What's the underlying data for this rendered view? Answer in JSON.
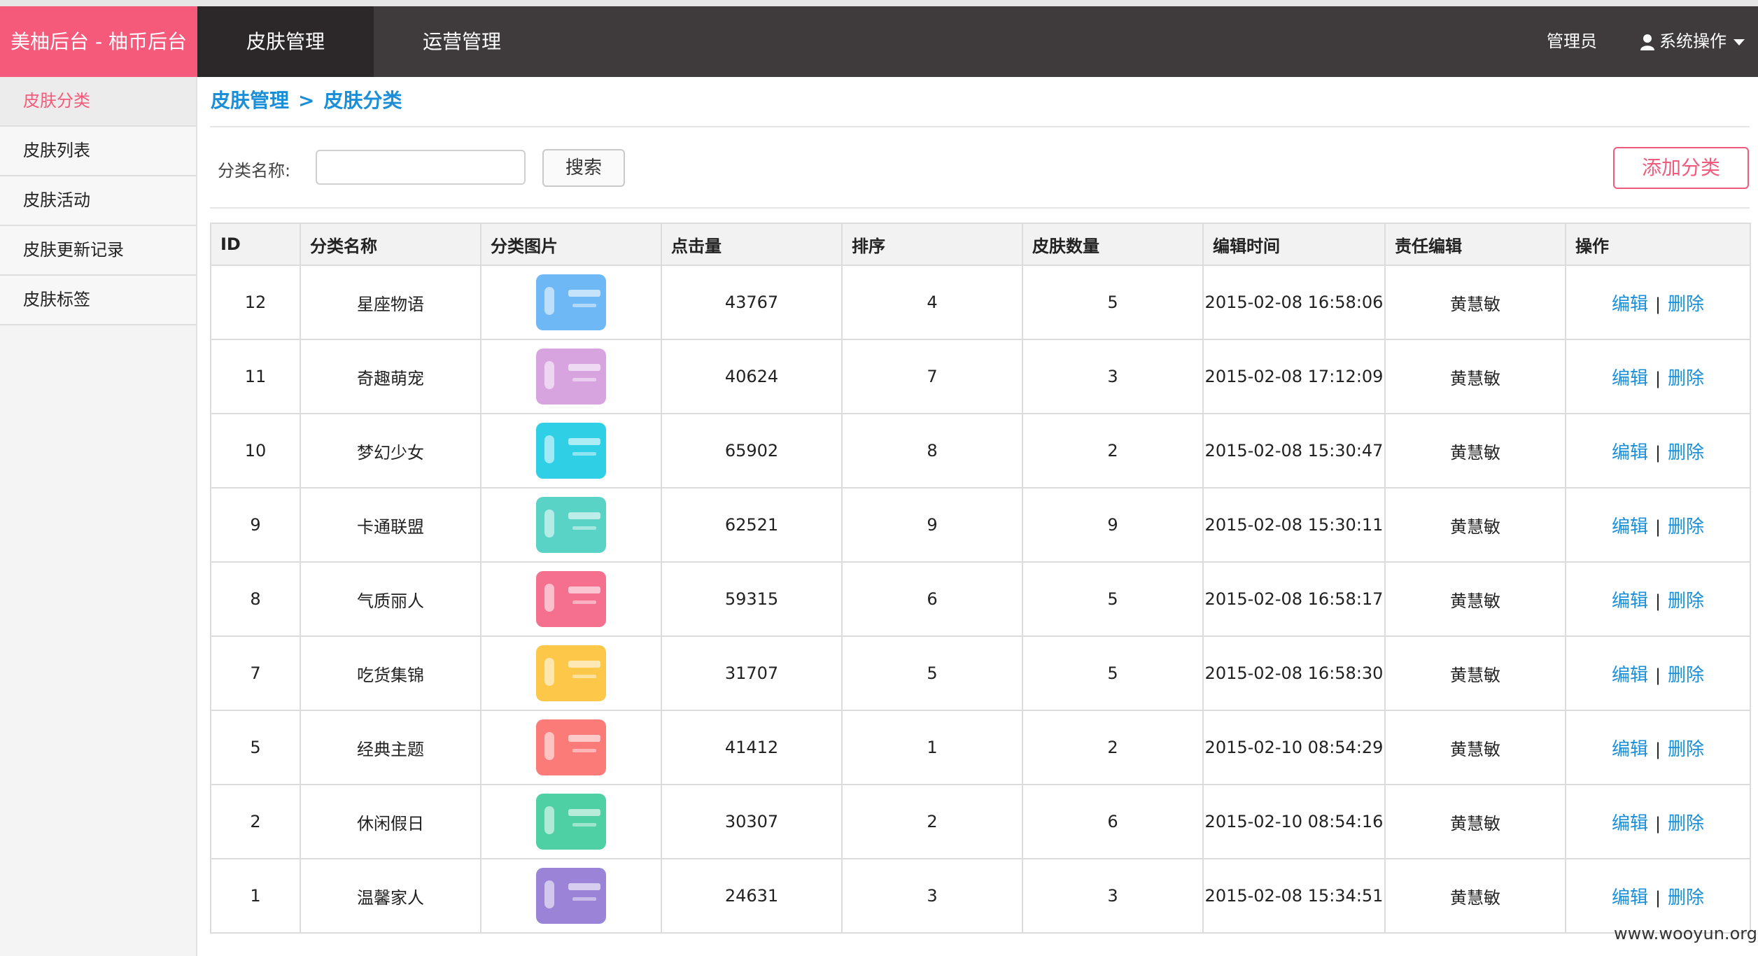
{
  "brand": "美柚后台 - 柚币后台",
  "top_nav": {
    "tab1": "皮肤管理",
    "tab2": "运营管理",
    "admin": "管理员",
    "system_ops": "系统操作"
  },
  "sidebar": {
    "items": [
      "皮肤分类",
      "皮肤列表",
      "皮肤活动",
      "皮肤更新记录",
      "皮肤标签"
    ]
  },
  "breadcrumb": {
    "parent": "皮肤管理",
    "separator": ">",
    "current": "皮肤分类"
  },
  "search": {
    "label": "分类名称:",
    "value": "",
    "button": "搜索"
  },
  "add_button": "添加分类",
  "table": {
    "headers": [
      "ID",
      "分类名称",
      "分类图片",
      "点击量",
      "排序",
      "皮肤数量",
      "编辑时间",
      "责任编辑",
      "操作"
    ],
    "edit_label": "编辑",
    "delete_label": "删除",
    "op_separator": "|",
    "rows": [
      {
        "id": "12",
        "name": "星座物语",
        "clicks": "43767",
        "order": "4",
        "count": "5",
        "time": "2015-02-08 16:58:06",
        "editor": "黄慧敏",
        "thumb_color": "#6eb8f5",
        "thumb_icon": "stars-icon"
      },
      {
        "id": "11",
        "name": "奇趣萌宠",
        "clicks": "40624",
        "order": "7",
        "count": "3",
        "time": "2015-02-08 17:12:09",
        "editor": "黄慧敏",
        "thumb_color": "#d7a4e0",
        "thumb_icon": "pet-icon"
      },
      {
        "id": "10",
        "name": "梦幻少女",
        "clicks": "65902",
        "order": "8",
        "count": "2",
        "time": "2015-02-08 15:30:47",
        "editor": "黄慧敏",
        "thumb_color": "#2fcfe6",
        "thumb_icon": "girl-icon"
      },
      {
        "id": "9",
        "name": "卡通联盟",
        "clicks": "62521",
        "order": "9",
        "count": "9",
        "time": "2015-02-08 15:30:11",
        "editor": "黄慧敏",
        "thumb_color": "#58d3c6",
        "thumb_icon": "cartoon-icon"
      },
      {
        "id": "8",
        "name": "气质丽人",
        "clicks": "59315",
        "order": "6",
        "count": "5",
        "time": "2015-02-08 16:58:17",
        "editor": "黄慧敏",
        "thumb_color": "#f56f8e",
        "thumb_icon": "feather-icon"
      },
      {
        "id": "7",
        "name": "吃货集锦",
        "clicks": "31707",
        "order": "5",
        "count": "5",
        "time": "2015-02-08 16:58:30",
        "editor": "黄慧敏",
        "thumb_color": "#fdc84a",
        "thumb_icon": "icecream-icon"
      },
      {
        "id": "5",
        "name": "经典主题",
        "clicks": "41412",
        "order": "1",
        "count": "2",
        "time": "2015-02-10 08:54:29",
        "editor": "黄慧敏",
        "thumb_color": "#fb7b78",
        "thumb_icon": "phone-icon"
      },
      {
        "id": "2",
        "name": "休闲假日",
        "clicks": "30307",
        "order": "2",
        "count": "6",
        "time": "2015-02-10 08:54:16",
        "editor": "黄慧敏",
        "thumb_color": "#4fd0a4",
        "thumb_icon": "luggage-icon"
      },
      {
        "id": "1",
        "name": "温馨家人",
        "clicks": "24631",
        "order": "3",
        "count": "3",
        "time": "2015-02-08 15:34:51",
        "editor": "黄慧敏",
        "thumb_color": "#9b84d8",
        "thumb_icon": "family-icon"
      }
    ]
  },
  "watermark": "www.wooyun.org"
}
